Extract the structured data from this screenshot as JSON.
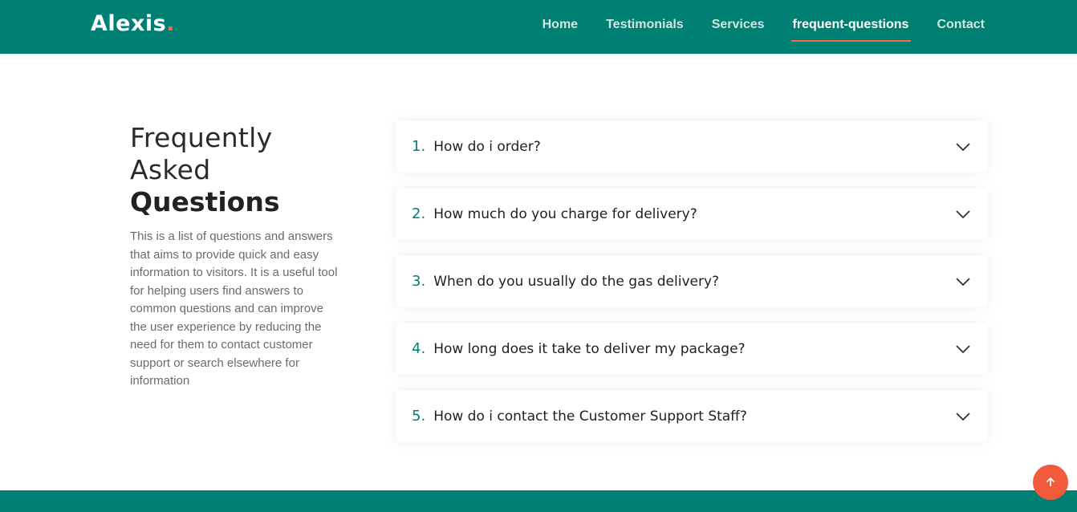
{
  "brand": {
    "name": "Alexis",
    "dot": "."
  },
  "nav": [
    {
      "label": "Home",
      "active": false
    },
    {
      "label": "Testimonials",
      "active": false
    },
    {
      "label": "Services",
      "active": false
    },
    {
      "label": "frequent-questions",
      "active": true
    },
    {
      "label": "Contact",
      "active": false
    }
  ],
  "intro": {
    "title_line1": "Frequently",
    "title_line2": "Asked",
    "title_bold": "Questions",
    "text": "This is a list of questions and answers that aims to provide quick and easy information to visitors. It is a useful tool for helping users find answers to common questions and can improve the user experience by reducing the need for them to contact customer support or search elsewhere for information"
  },
  "faqs": [
    {
      "num": "1.",
      "question": "How do i order?"
    },
    {
      "num": "2.",
      "question": "How much do you charge for delivery?"
    },
    {
      "num": "3.",
      "question": "When do you usually do the gas delivery?"
    },
    {
      "num": "4.",
      "question": "How long does it take to deliver my package?"
    },
    {
      "num": "5.",
      "question": "How do i contact the Customer Support Staff?"
    }
  ],
  "icons": {
    "faq_toggle": "chevron-down-icon",
    "scroll_top": "arrow-up-icon"
  },
  "colors": {
    "primary": "#007f73",
    "accent": "#f26b4b",
    "scroll_button": "#f15a3b"
  }
}
